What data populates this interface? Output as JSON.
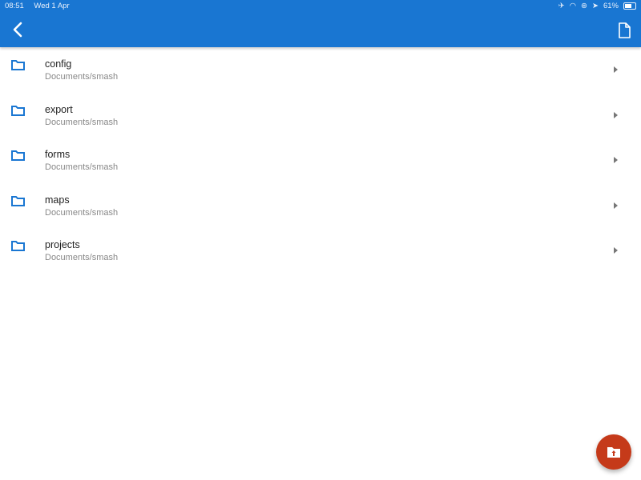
{
  "status_bar": {
    "time": "08:51",
    "date": "Wed 1 Apr",
    "battery": "61%",
    "icons": [
      "airplane-icon",
      "wifi-icon",
      "orientation-lock-icon",
      "location-icon",
      "battery-icon"
    ]
  },
  "app_bar": {
    "back_icon": "chevron-left-icon",
    "action_icon": "new-file-icon",
    "background": "#1976d2"
  },
  "folders": [
    {
      "name": "config",
      "path": "Documents/smash"
    },
    {
      "name": "export",
      "path": "Documents/smash"
    },
    {
      "name": "forms",
      "path": "Documents/smash"
    },
    {
      "name": "maps",
      "path": "Documents/smash"
    },
    {
      "name": "projects",
      "path": "Documents/smash"
    }
  ],
  "fab": {
    "icon": "folder-upload-icon",
    "color": "#c53a1a"
  }
}
